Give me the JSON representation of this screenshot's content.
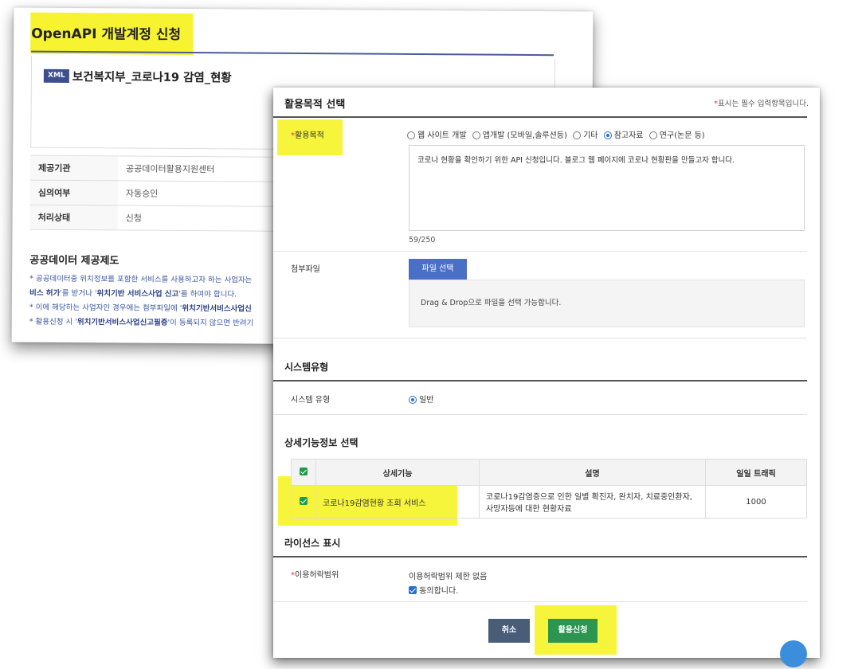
{
  "back_panel": {
    "title": "OpenAPI 개발계정 신청",
    "badge": "XML",
    "service_name": "보건복지부_코로나19 감염_현황",
    "info": [
      {
        "key": "제공기관",
        "value": "공공데이터활용지원센터"
      },
      {
        "key": "심의여부",
        "value": "자동승인"
      },
      {
        "key": "처리상태",
        "value": "신청"
      }
    ],
    "section_title": "공공데이터 제공제도",
    "notes": {
      "line1": "* 공공데이터중 위치정보를 포함한 서비스를 사용하고자 하는 사업자는",
      "line2_bold1": "비스 허가",
      "line2_mid": "'를 받거나 '",
      "line2_bold2": "위치기반 서비스사업 신고",
      "line2_end": "'를 하여야 합니다.",
      "line3_pre": "* 이에 해당하는 사업자인 경우에는 첨부파일에 '",
      "line3_bold": "위치기반서비스사업신",
      "line4_pre": "* 활용신청 시 '",
      "line4_bold": "위치기반서비스사업신고필증",
      "line4_end": "'이 등록되지 않으면 반려기"
    }
  },
  "front_panel": {
    "purpose_title": "활용목적 선택",
    "required_note_star": "*",
    "required_note": "표시는 필수 입력항목입니다.",
    "purpose_label": "활용목적",
    "purpose_options": [
      {
        "label": "웹 사이트 개발",
        "selected": false
      },
      {
        "label": "앱개발 (모바일,솔루션등)",
        "selected": false
      },
      {
        "label": "기타",
        "selected": false
      },
      {
        "label": "참고자료",
        "selected": true
      },
      {
        "label": "연구(논문 등)",
        "selected": false
      }
    ],
    "purpose_text": "코로나 현황을 확인하기 위한 API 신청입니다.   블로그 웹 페이지에 코로나 현황판을 만들고자 합니다.",
    "char_counter": "59/250",
    "attach_label": "첨부파일",
    "file_button": "파일 선택",
    "drop_text": "Drag & Drop으로 파일을 선택 가능합니다.",
    "system_section": "시스템유형",
    "system_label": "시스템 유형",
    "system_value": "일반",
    "detail_section": "상세기능정보 선택",
    "table_headers": [
      "상세기능",
      "설명",
      "일일 트래픽"
    ],
    "table_rows": [
      {
        "feature": "코로나19감염현황 조회 서비스",
        "desc1": "코로나19감염증으로 인한 일별 확진자, 완치자, 치료중인환자,",
        "desc2": "사망자등에 대한 현황자료",
        "traffic": "1000",
        "checked": true
      }
    ],
    "license_section": "라이선스 표시",
    "license_label": "이용허락범위",
    "license_value": "이용허락범위 제한 없음",
    "agree_label": "동의합니다.",
    "cancel_button": "취소",
    "apply_button": "활용신청"
  },
  "colors": {
    "highlight": "#f6f21a",
    "title_line": "#4b5a9b",
    "file_button": "#4a6fc6",
    "cancel_button": "#4a5d78",
    "apply_button": "#2c9550",
    "checkbox_green": "#1f9a4b",
    "radio_blue": "#2a6fd6"
  }
}
